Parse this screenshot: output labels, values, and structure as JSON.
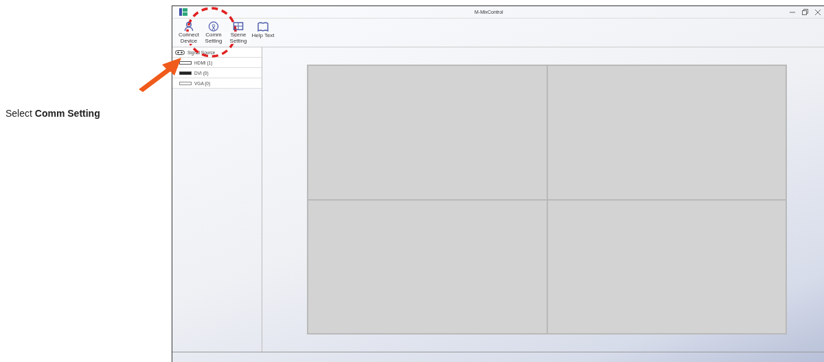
{
  "caption": "Select **Comm Setting**",
  "window": {
    "title": "M-MixControl"
  },
  "toolbar": [
    {
      "label": "Connect Device",
      "kind": "device"
    },
    {
      "label": "Comm Setting",
      "kind": "comm"
    },
    {
      "label": "Scene Setting",
      "kind": "scene"
    },
    {
      "label": "Help Text",
      "kind": "help"
    }
  ],
  "sidebar": {
    "title": "Signal Source",
    "items": [
      {
        "label": "HDMI (1)",
        "kind": "hdmi"
      },
      {
        "label": "DVI (0)",
        "kind": "dvi"
      },
      {
        "label": "VGA (0)",
        "kind": "vga"
      }
    ]
  }
}
